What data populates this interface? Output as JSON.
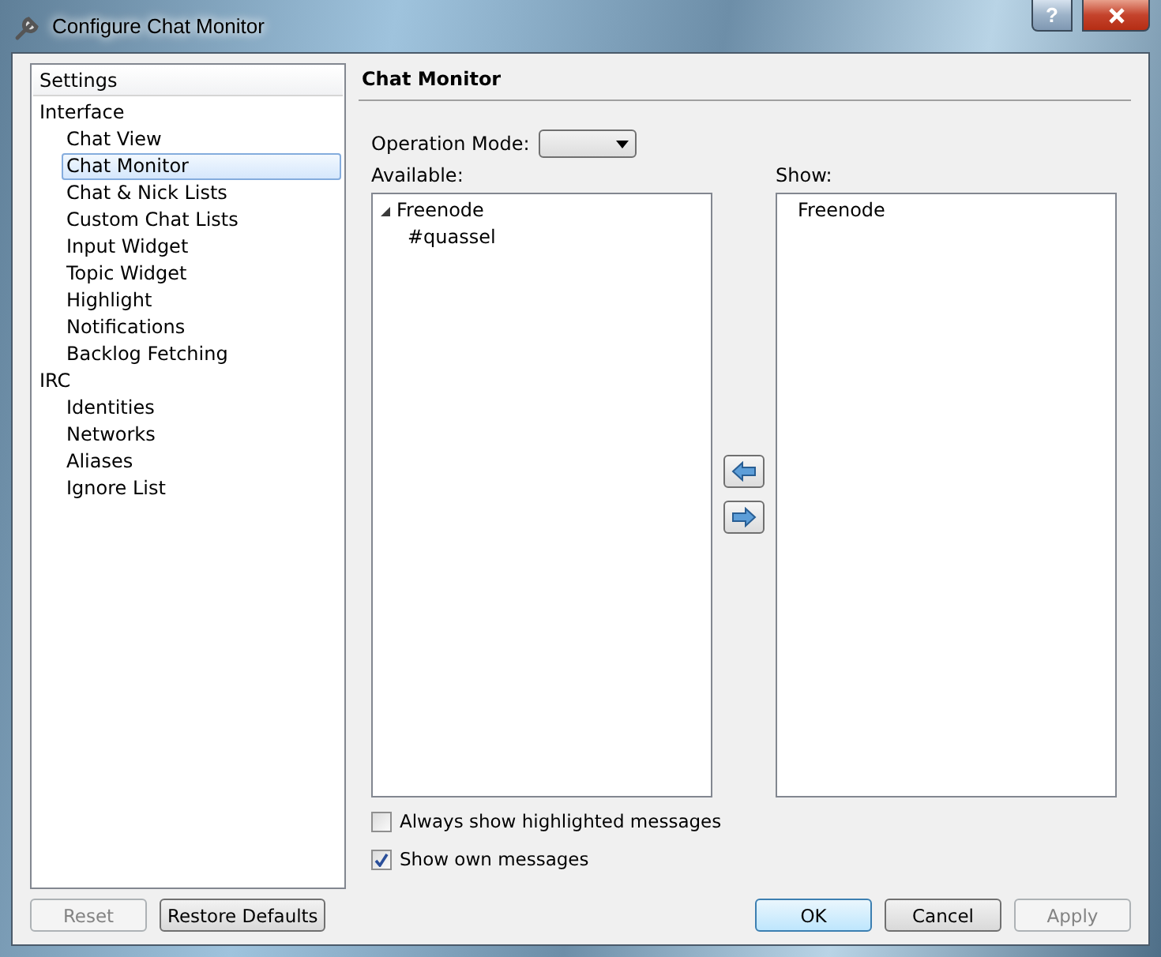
{
  "window": {
    "title": "Configure Chat Monitor",
    "help_button": "?"
  },
  "settings_tree": {
    "header": "Settings",
    "items": [
      {
        "label": "Interface",
        "selected": false,
        "children": [
          {
            "label": "Chat View",
            "selected": false
          },
          {
            "label": "Chat Monitor",
            "selected": true
          },
          {
            "label": "Chat & Nick Lists",
            "selected": false
          },
          {
            "label": "Custom Chat Lists",
            "selected": false
          },
          {
            "label": "Input Widget",
            "selected": false
          },
          {
            "label": "Topic Widget",
            "selected": false
          },
          {
            "label": "Highlight",
            "selected": false
          },
          {
            "label": "Notifications",
            "selected": false
          },
          {
            "label": "Backlog Fetching",
            "selected": false
          }
        ]
      },
      {
        "label": "IRC",
        "selected": false,
        "children": [
          {
            "label": "Identities",
            "selected": false
          },
          {
            "label": "Networks",
            "selected": false
          },
          {
            "label": "Aliases",
            "selected": false
          },
          {
            "label": "Ignore List",
            "selected": false
          }
        ]
      }
    ]
  },
  "page": {
    "title": "Chat Monitor",
    "operation_mode": {
      "label": "Operation Mode:"
    },
    "available": {
      "label": "Available:",
      "items": [
        {
          "label": "Freenode",
          "expanded": true,
          "children": [
            {
              "label": "#quassel"
            }
          ]
        }
      ]
    },
    "show": {
      "label": "Show:",
      "items": [
        {
          "label": "Freenode"
        }
      ]
    },
    "checkboxes": [
      {
        "label": "Always show highlighted messages",
        "checked": false
      },
      {
        "label": "Show own messages",
        "checked": true
      }
    ]
  },
  "left_buttons": [
    {
      "label": "Reset",
      "disabled": true,
      "default": false
    },
    {
      "label": "Restore Defaults",
      "disabled": false,
      "default": false
    }
  ],
  "right_buttons": [
    {
      "label": "OK",
      "disabled": false,
      "default": true
    },
    {
      "label": "Cancel",
      "disabled": false,
      "default": false
    },
    {
      "label": "Apply",
      "disabled": true,
      "default": false
    }
  ]
}
